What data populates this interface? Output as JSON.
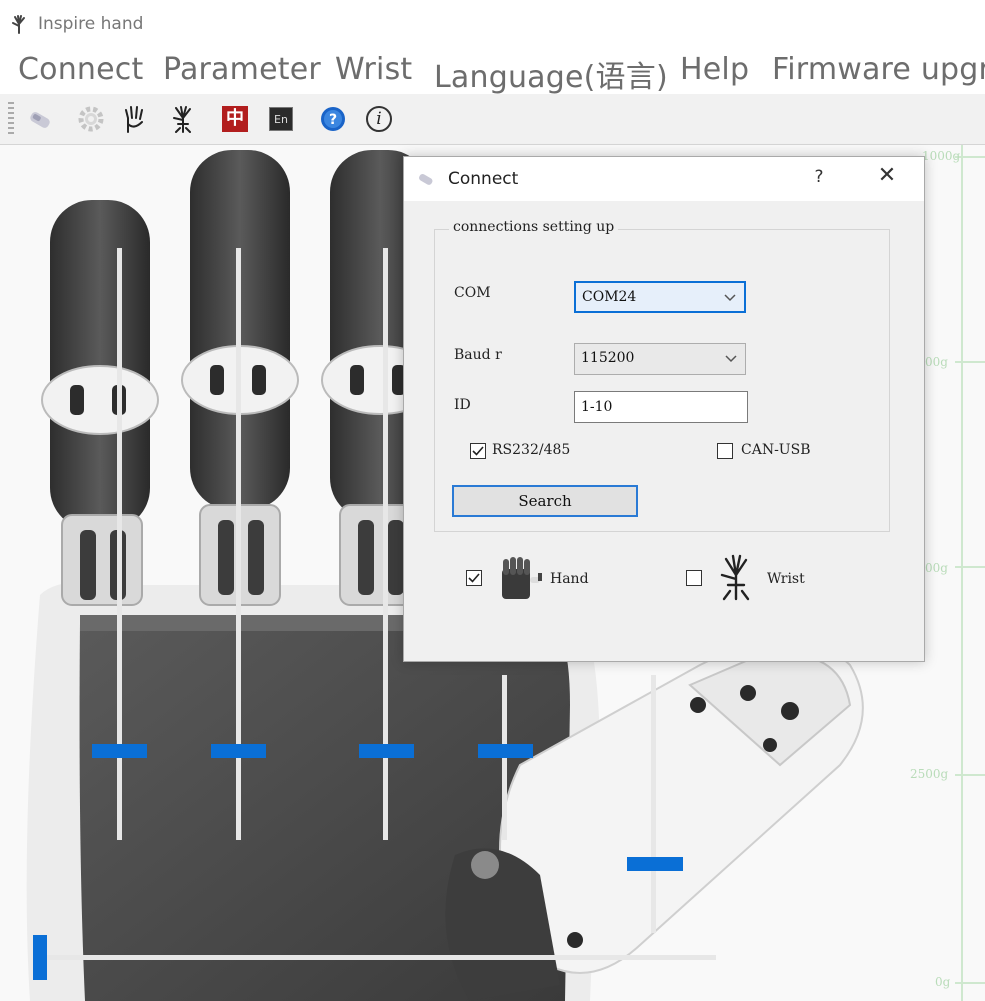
{
  "app": {
    "title": "Inspire hand"
  },
  "menu": {
    "items": [
      "Connect",
      "Parameter",
      "Wrist",
      "Language(语言)",
      "Help",
      "Firmware upgra"
    ]
  },
  "toolbar": {
    "icons": [
      "connect-plug-icon",
      "gear-icon",
      "hand-gesture-icon",
      "wrist-hand-icon",
      "chinese-language-icon",
      "english-language-icon",
      "help-icon",
      "info-icon"
    ],
    "zh_label": "中",
    "en_label": "En",
    "info_label": "i"
  },
  "axis": {
    "labels": [
      "1000g",
      "00g",
      "00g",
      "2500g",
      "0g"
    ]
  },
  "sliders": {
    "finger_levels": [
      0.15,
      0.15,
      0.15,
      0.15,
      0.12
    ],
    "bottom_level": 0.0
  },
  "dialog": {
    "title": "Connect",
    "help": "?",
    "close": "✕",
    "group_title": "connections setting up",
    "com_label": "COM",
    "com_value": "COM24",
    "baud_label": "Baud r",
    "baud_value": "115200",
    "id_label": "ID",
    "id_value": "1-10",
    "rs_label": "RS232/485",
    "rs_checked": true,
    "can_label": "CAN-USB",
    "can_checked": false,
    "search_label": "Search",
    "hand_label": "Hand",
    "hand_checked": true,
    "wrist_label": "Wrist",
    "wrist_checked": false
  },
  "colors": {
    "accent": "#0a6fd6",
    "hand_dark": "#4a4a4a",
    "axis_green": "#b9dcb9"
  }
}
